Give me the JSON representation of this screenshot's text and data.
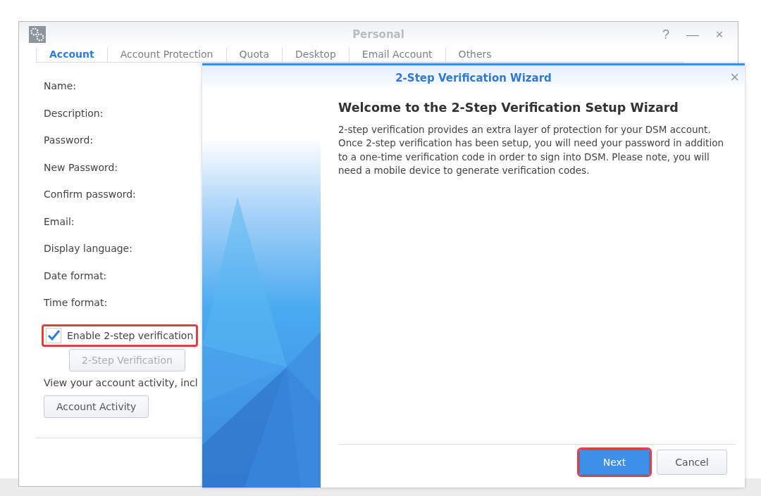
{
  "window": {
    "title": "Personal",
    "controls": [
      "?",
      "—",
      "×"
    ]
  },
  "tabs": [
    {
      "label": "Account",
      "selected": true
    },
    {
      "label": "Account Protection",
      "selected": false
    },
    {
      "label": "Quota",
      "selected": false
    },
    {
      "label": "Desktop",
      "selected": false
    },
    {
      "label": "Email Account",
      "selected": false
    },
    {
      "label": "Others",
      "selected": false
    }
  ],
  "form_labels": [
    "Name:",
    "Description:",
    "Password:",
    "New Password:",
    "Confirm password:",
    "Email:",
    "Display language:",
    "Date format:",
    "Time format:"
  ],
  "two_step": {
    "label": "Enable 2-step verification",
    "checked": true,
    "highlighted": true
  },
  "two_step_button": {
    "label": "2-Step Verification",
    "disabled": true
  },
  "activity_text": "View your account activity, incl",
  "activity_button": {
    "label": "Account Activity",
    "disabled": false
  },
  "wizard": {
    "title": "2-Step Verification Wizard",
    "close": "×",
    "heading": "Welcome to the 2-Step Verification Setup Wizard",
    "body": "2-step verification provides an extra layer of protection for your DSM account. Once 2-step verification has been setup, you will need your password in addition to a one-time verification code in order to sign into DSM. Please note, you will need a mobile device to generate verification codes.",
    "buttons": [
      {
        "label": "Next",
        "kind": "primary",
        "highlighted": true
      },
      {
        "label": "Cancel",
        "kind": "secondary",
        "highlighted": false
      }
    ]
  }
}
